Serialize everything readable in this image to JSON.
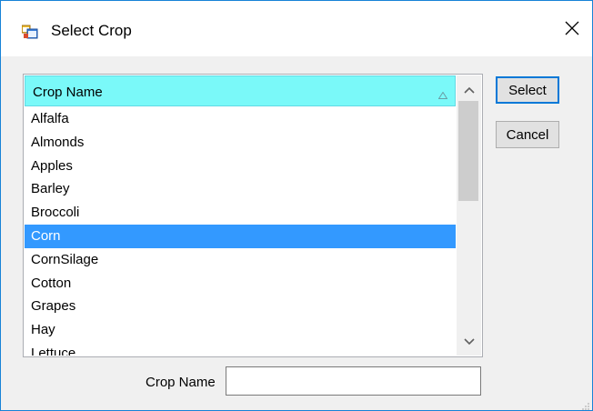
{
  "window": {
    "title": "Select Crop",
    "app_icon": "app-window-icon",
    "close_icon": "close-icon"
  },
  "list": {
    "column_header": "Crop Name",
    "sort_icon": "sort-ascending-icon",
    "rows": [
      "Alfalfa",
      "Almonds",
      "Apples",
      "Barley",
      "Broccoli",
      "Corn",
      "CornSilage",
      "Cotton",
      "Grapes",
      "Hay",
      "Lettuce"
    ],
    "selected": "Corn",
    "colors": {
      "header_bg": "#7af9f9",
      "selected_bg": "#3399ff"
    }
  },
  "buttons": {
    "select_label": "Select",
    "cancel_label": "Cancel"
  },
  "filter": {
    "label": "Crop Name",
    "value": ""
  },
  "colors": {
    "accent": "#0078d7"
  }
}
